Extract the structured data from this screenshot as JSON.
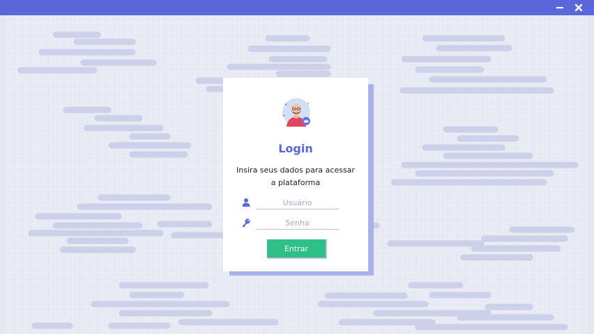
{
  "window": {
    "minimize_glyph": "—",
    "close_glyph": "✕",
    "accent": "#5a67d8"
  },
  "login": {
    "title": "Login",
    "subtitle": "Insira seus dados para acessar a plataforma",
    "user_placeholder": "Usuário",
    "user_value": "",
    "password_placeholder": "Senha",
    "password_value": "",
    "submit_label": "Entrar",
    "submit_color": "#2ebf86"
  },
  "icons": {
    "avatar": "user-avatar-icon",
    "user": "user-icon",
    "password": "key-icon",
    "minimize": "minimize-icon",
    "close": "close-icon"
  }
}
